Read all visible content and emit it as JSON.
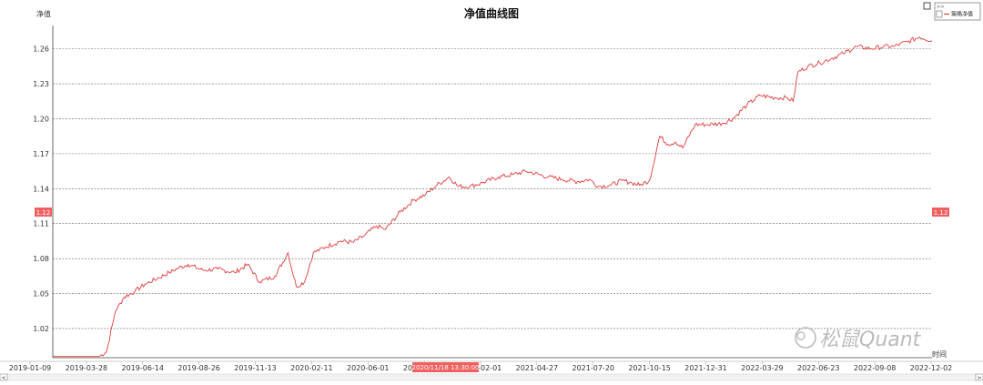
{
  "chart_data": {
    "type": "line",
    "title": "净值曲线图",
    "ylabel": "净值",
    "xlabel": "时间",
    "ylim": [
      0.995,
      1.28
    ],
    "yticks": [
      1.02,
      1.05,
      1.08,
      1.11,
      1.14,
      1.17,
      1.2,
      1.23,
      1.26
    ],
    "ytick_labels": [
      "1.02",
      "1.05",
      "1.08",
      "1.11",
      "1.14",
      "1.17",
      "1.20",
      "1.23",
      "1.26"
    ],
    "xtick_labels": [
      "2019-01-09",
      "2019-03-28",
      "2019-06-14",
      "2019-08-26",
      "2019-11-13",
      "2020-02-11",
      "2020-06-01",
      "2020-08-19",
      "2021-02-01",
      "2021-04-27",
      "2021-07-20",
      "2021-10-15",
      "2021-12-31",
      "2022-03-29",
      "2022-06-23",
      "2022-09-08",
      "2022-12-02"
    ],
    "cursor_date_label": "2020/11/18 13:30:00",
    "cursor_value_label": "1.12",
    "cursor_value": 1.12,
    "grid": true,
    "legend_position": "top-right",
    "series": [
      {
        "name": "策略净值",
        "color": "#e03c3c",
        "x": [
          "2019-01-09",
          "2019-03-15",
          "2019-03-28",
          "2019-04-10",
          "2019-04-25",
          "2019-05-10",
          "2019-05-28",
          "2019-06-14",
          "2019-07-05",
          "2019-07-25",
          "2019-08-10",
          "2019-08-26",
          "2019-09-20",
          "2019-10-15",
          "2019-11-13",
          "2019-12-05",
          "2019-12-25",
          "2020-01-20",
          "2020-02-11",
          "2020-02-25",
          "2020-03-10",
          "2020-03-25",
          "2020-04-15",
          "2020-05-10",
          "2020-06-01",
          "2020-06-20",
          "2020-07-10",
          "2020-07-25",
          "2020-08-19",
          "2020-09-10",
          "2020-10-01",
          "2020-10-20",
          "2020-11-10",
          "2020-11-25",
          "2020-12-15",
          "2021-01-05",
          "2021-02-01",
          "2021-02-25",
          "2021-03-20",
          "2021-04-27",
          "2021-05-20",
          "2021-06-15",
          "2021-07-05",
          "2021-07-20",
          "2021-08-10",
          "2021-08-30",
          "2021-09-15",
          "2021-09-28",
          "2021-10-15",
          "2021-11-01",
          "2021-11-15",
          "2021-11-28",
          "2021-12-10",
          "2021-12-31",
          "2022-01-20",
          "2022-02-15",
          "2022-03-05",
          "2022-03-29",
          "2022-04-20",
          "2022-05-15",
          "2022-06-05",
          "2022-06-15",
          "2022-06-23",
          "2022-07-10",
          "2022-07-30",
          "2022-08-20",
          "2022-09-08",
          "2022-09-30",
          "2022-10-25",
          "2022-11-15",
          "2022-12-02",
          "2022-12-25",
          "2023-01-15",
          "2023-02-05"
        ],
        "y": [
          0.996,
          0.996,
          0.996,
          1.0,
          1.035,
          1.047,
          1.052,
          1.058,
          1.063,
          1.068,
          1.072,
          1.075,
          1.07,
          1.071,
          1.068,
          1.075,
          1.06,
          1.065,
          1.085,
          1.056,
          1.06,
          1.085,
          1.09,
          1.095,
          1.094,
          1.1,
          1.108,
          1.105,
          1.12,
          1.13,
          1.135,
          1.143,
          1.15,
          1.142,
          1.142,
          1.145,
          1.15,
          1.152,
          1.155,
          1.15,
          1.148,
          1.146,
          1.148,
          1.142,
          1.143,
          1.147,
          1.145,
          1.143,
          1.147,
          1.185,
          1.178,
          1.18,
          1.175,
          1.195,
          1.195,
          1.196,
          1.2,
          1.212,
          1.22,
          1.218,
          1.218,
          1.215,
          1.24,
          1.245,
          1.248,
          1.252,
          1.256,
          1.262,
          1.26,
          1.262,
          1.262,
          1.266,
          1.27,
          1.267
        ]
      }
    ]
  },
  "watermark": "松鼠Quant",
  "controls": {
    "legend_toggle_label": ">>",
    "fullscreen_box": "□",
    "scroll_left": "<",
    "scroll_right": ">"
  }
}
